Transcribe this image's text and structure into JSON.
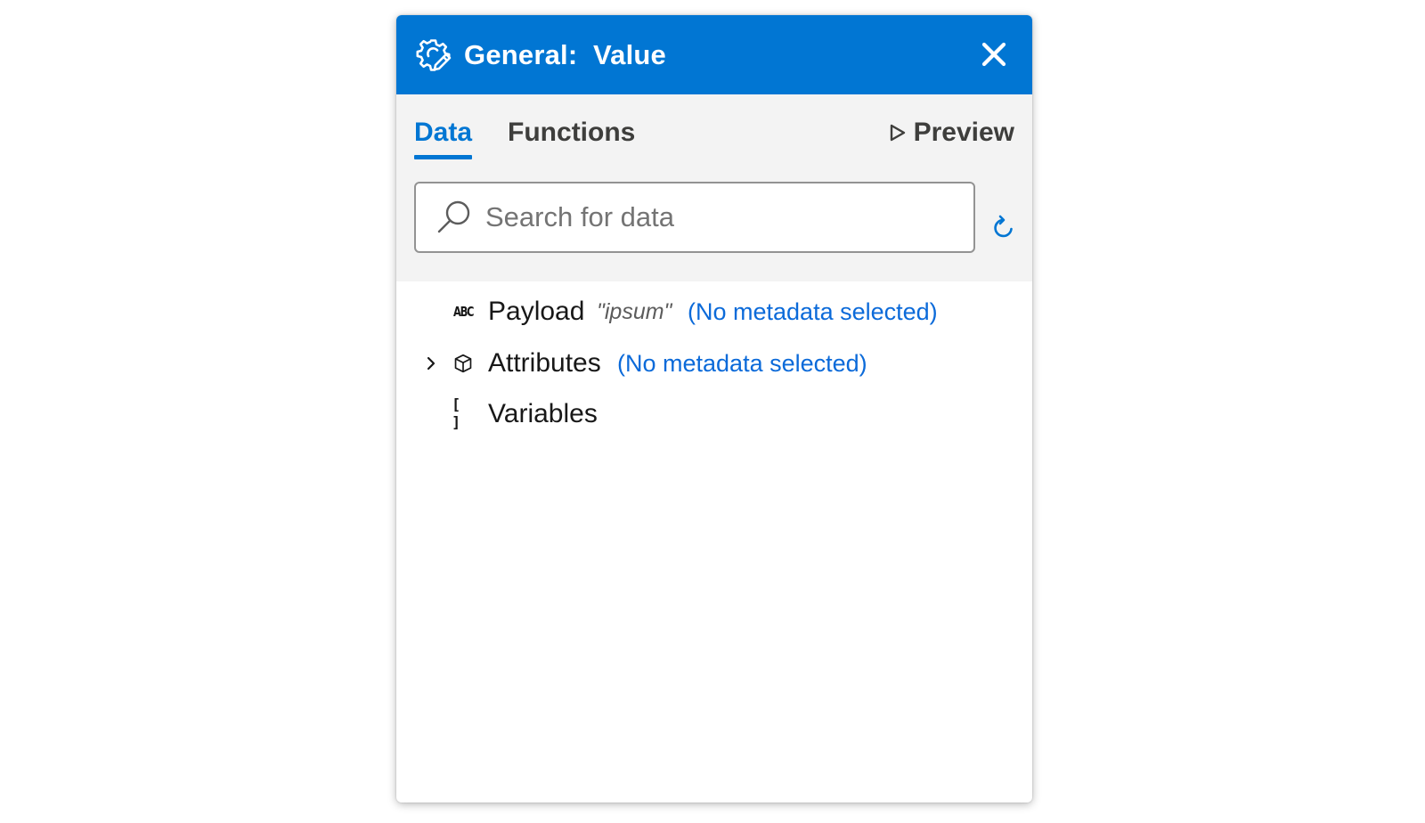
{
  "header": {
    "title": "General:  Value",
    "close_label": "Close"
  },
  "tabs": [
    {
      "label": "Data",
      "active": true
    },
    {
      "label": "Functions",
      "active": false
    }
  ],
  "preview": {
    "label": "Preview"
  },
  "search": {
    "placeholder": "Search for data",
    "value": ""
  },
  "tree": {
    "items": [
      {
        "name": "Payload",
        "type_icon": "abc-string-icon",
        "type_label": "ABC",
        "sample_value": "\"ipsum\"",
        "metadata": "(No metadata selected)",
        "expandable": false
      },
      {
        "name": "Attributes",
        "type_icon": "cube-object-icon",
        "metadata": "(No metadata selected)",
        "expandable": true
      },
      {
        "name": "Variables",
        "type_icon": "brackets-array-icon",
        "type_label": "[ ]",
        "expandable": false
      }
    ]
  },
  "colors": {
    "header_bg": "#0176d3",
    "accent": "#0176d3",
    "link": "#0b6ad9",
    "toolbar_bg": "#f3f3f3"
  }
}
